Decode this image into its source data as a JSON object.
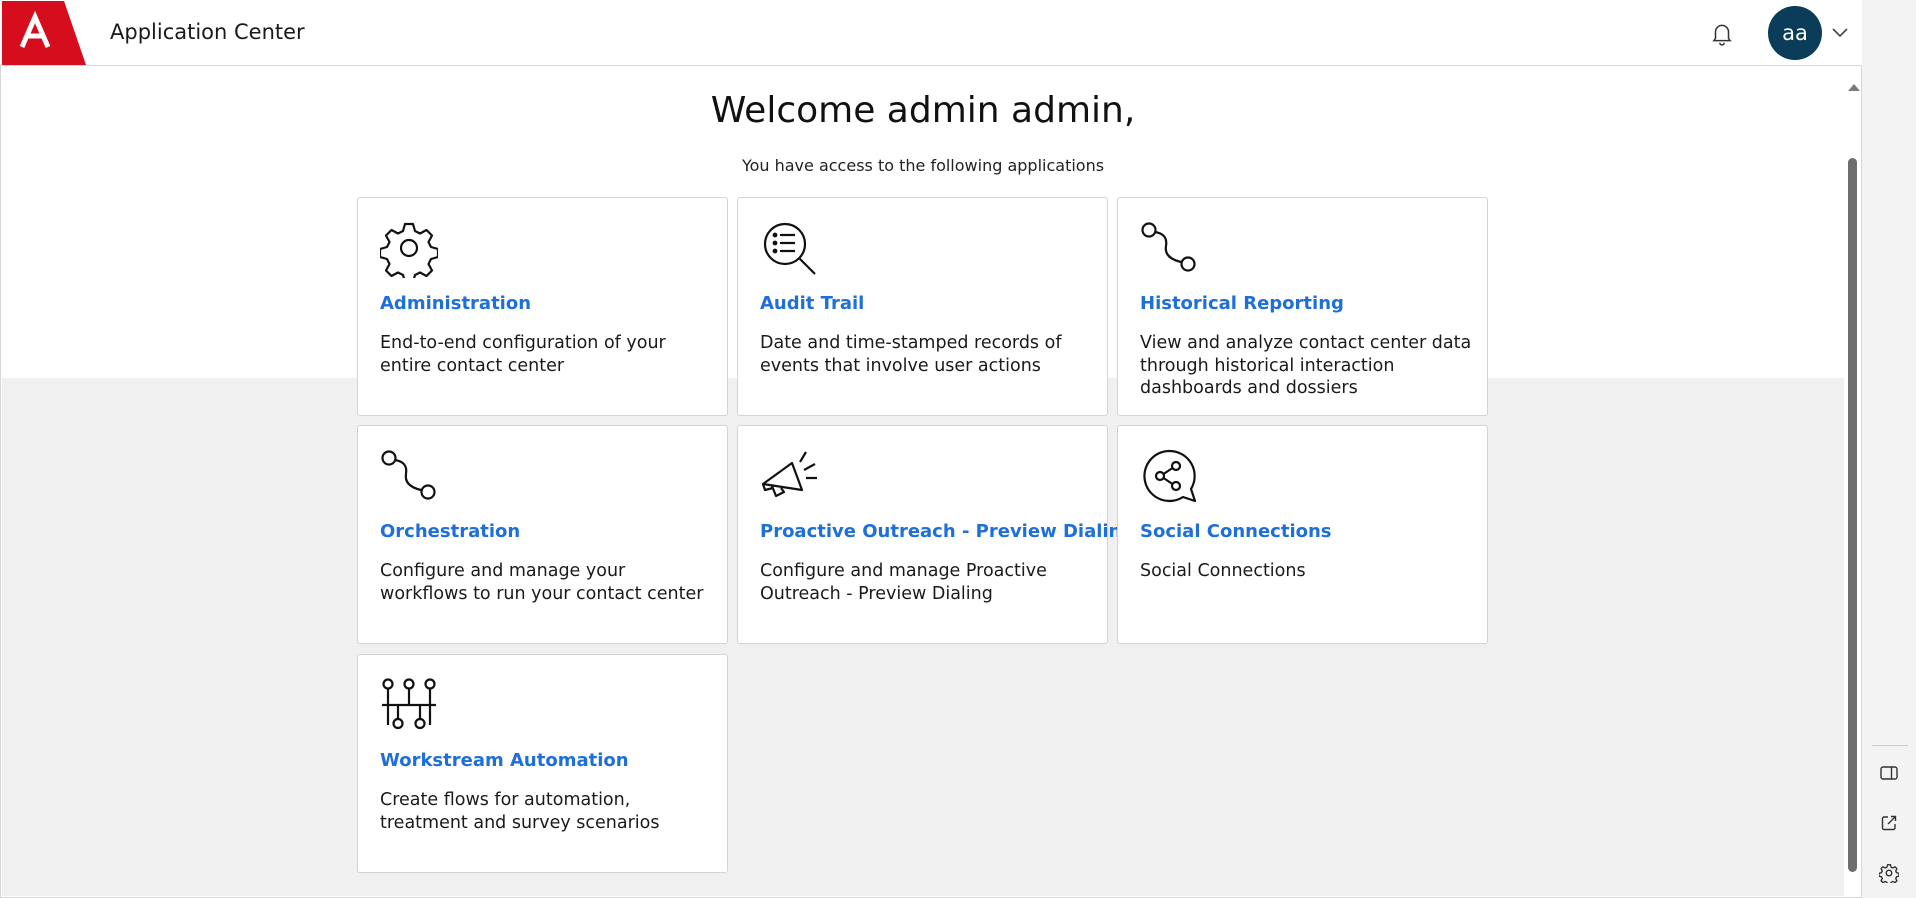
{
  "header": {
    "app_title": "Application Center",
    "brand_color": "#d50d1c",
    "avatar_initials": "aa",
    "avatar_color": "#0b3d5a"
  },
  "main": {
    "welcome": "Welcome admin admin,",
    "subtitle": "You have access to the following applications",
    "link_color": "#1e6fd9",
    "apps": [
      {
        "icon": "gear-icon",
        "title": "Administration",
        "description": "End-to-end configuration of your entire contact center"
      },
      {
        "icon": "search-list-icon",
        "title": "Audit Trail",
        "description": "Date and time-stamped records of events that involve user actions"
      },
      {
        "icon": "path-nodes-icon",
        "title": "Historical Reporting",
        "description": "View and analyze contact center data through historical interaction dashboards and dossiers"
      },
      {
        "icon": "path-nodes-icon",
        "title": "Orchestration",
        "description": "Configure and manage your workflows to run your contact center"
      },
      {
        "icon": "megaphone-icon",
        "title": "Proactive Outreach - Preview Dialing",
        "description": "Configure and manage Proactive Outreach - Preview Dialing"
      },
      {
        "icon": "share-bubble-icon",
        "title": "Social Connections",
        "description": "Social Connections"
      },
      {
        "icon": "workflow-nodes-icon",
        "title": "Workstream Automation",
        "description": "Create flows for automation, treatment and survey scenarios"
      }
    ]
  },
  "side_panel": {
    "icons": [
      "sidebar-toggle-icon",
      "external-link-icon",
      "settings-gear-icon"
    ]
  }
}
